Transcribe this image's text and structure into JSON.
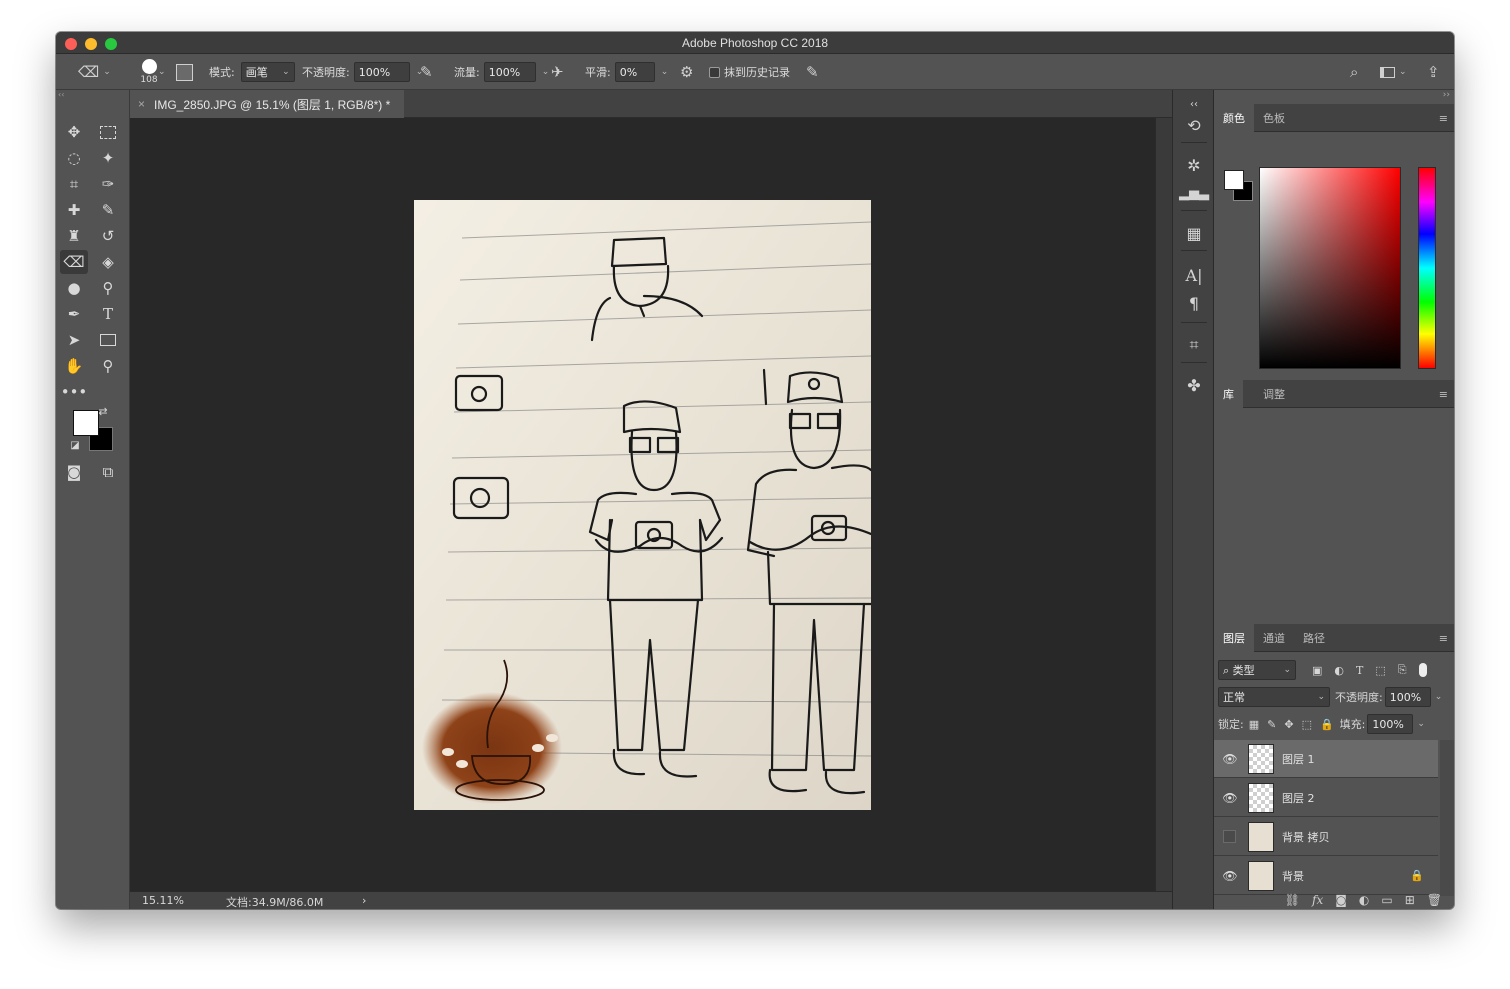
{
  "window": {
    "title": "Adobe Photoshop CC 2018"
  },
  "options_bar": {
    "brush_size": "108",
    "mode_label": "模式:",
    "mode_value": "画笔",
    "opacity_label": "不透明度:",
    "opacity_value": "100%",
    "flow_label": "流量:",
    "flow_value": "100%",
    "smoothing_label": "平滑:",
    "smoothing_value": "0%",
    "erase_history_label": "抹到历史记录"
  },
  "document": {
    "tab_title": "IMG_2850.JPG @ 15.1% (图层 1, RGB/8*) *"
  },
  "status": {
    "zoom": "15.11%",
    "doc_size": "文档:34.9M/86.0M"
  },
  "color_panel": {
    "tabs": [
      "颜色",
      "色板"
    ],
    "foreground": "#ffffff",
    "background": "#000000"
  },
  "library_panel": {
    "tabs": [
      "库",
      "调整"
    ]
  },
  "layers_panel": {
    "tabs": [
      "图层",
      "通道",
      "路径"
    ],
    "filter_label": "类型",
    "blend_mode": "正常",
    "opacity_label": "不透明度:",
    "opacity_value": "100%",
    "lock_label": "锁定:",
    "fill_label": "填充:",
    "fill_value": "100%",
    "layers": [
      {
        "name": "图层 1",
        "visible": true,
        "selected": true
      },
      {
        "name": "图层 2",
        "visible": true,
        "selected": false
      },
      {
        "name": "背景 拷贝",
        "visible": false,
        "selected": false
      },
      {
        "name": "背景",
        "visible": true,
        "selected": false,
        "locked": true
      }
    ]
  },
  "colors": {
    "panel_bg": "#535353",
    "canvas_bg": "#282828",
    "accent_selected": "#6a6a6a"
  }
}
